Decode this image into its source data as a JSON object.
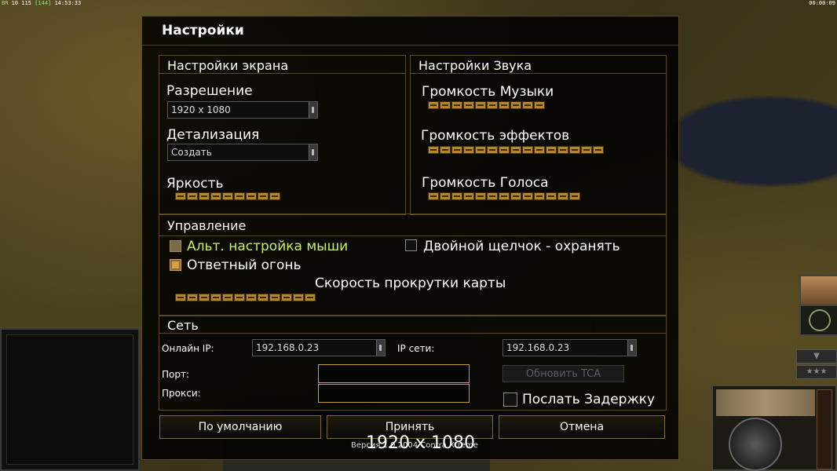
{
  "status_bar": {
    "left_prefix": "BR",
    "left_nums": "10 115",
    "left_fps": "[144]",
    "left_time": "14:53:33",
    "right_time": "00:00:09"
  },
  "dialog": {
    "title": "Настройки",
    "screen": {
      "title": "Настройки экрана",
      "resolution_label": "Разрешение",
      "resolution_value": "1920 x 1080",
      "detail_label": "Детализация",
      "detail_value": "Создать",
      "brightness_label": "Яркость",
      "brightness_level": 9
    },
    "sound": {
      "title": "Настройки Звука",
      "music_label": "Громкость Музыки",
      "music_level": 10,
      "effects_label": "Громкость эффектов",
      "effects_level": 15,
      "voice_label": "Громкость Голоса",
      "voice_level": 13
    },
    "control": {
      "title": "Управление",
      "alt_mouse_label": "Альт. настройка мыши",
      "alt_mouse_checked": false,
      "double_click_label": "Двойной щелчок - охранять",
      "double_click_checked": false,
      "return_fire_label": "Ответный огонь",
      "return_fire_checked": true,
      "scroll_label": "Скорость прокрутки карты",
      "scroll_level": 12
    },
    "network": {
      "title": "Сеть",
      "online_ip_label": "Онлайн IP:",
      "online_ip_value": "192.168.0.23",
      "lan_ip_label": "IP сети:",
      "lan_ip_value": "192.168.0.23",
      "port_label": "Порт:",
      "port_value": "",
      "proxy_label": "Прокси:",
      "proxy_value": "",
      "update_tca_label": "Обновить TCA",
      "send_delay_label": "Послать Задержку",
      "send_delay_checked": false
    },
    "buttons": {
      "default": "По умолчанию",
      "accept": "Принять",
      "cancel": "Отмена"
    },
    "version_text": "Версия 1.0 2004 Contra Xtreme",
    "resolution_overlay": "1920 x 1080"
  },
  "colors": {
    "accent_gold": "#b5862a",
    "highlight_green": "#c8f060",
    "border": "#5a4a24"
  }
}
